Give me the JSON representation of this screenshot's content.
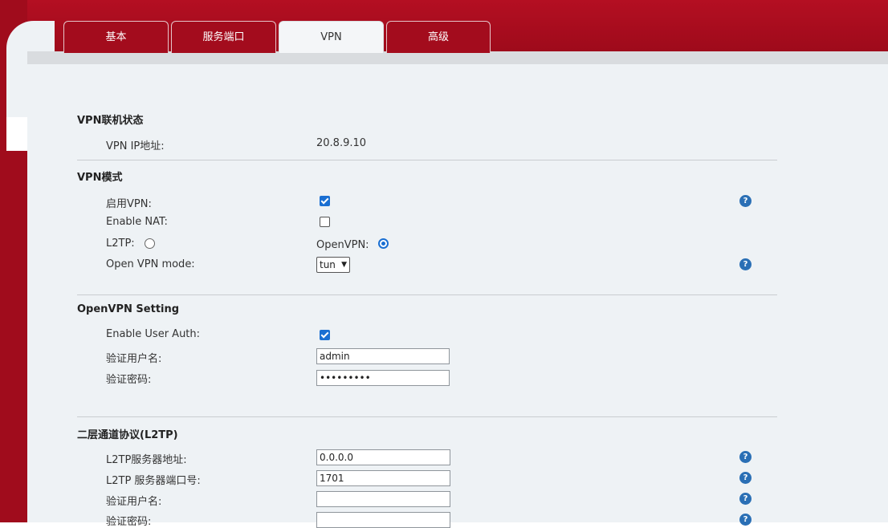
{
  "tabs": [
    {
      "label": "基本",
      "active": false
    },
    {
      "label": "服务端口",
      "active": false
    },
    {
      "label": "VPN",
      "active": true
    },
    {
      "label": "高级",
      "active": false
    }
  ],
  "vpn_status": {
    "title": "VPN联机状态",
    "ip_label": "VPN IP地址:",
    "ip_value": "20.8.9.10"
  },
  "vpn_mode": {
    "title": "VPN模式",
    "enable_vpn_label": "启用VPN:",
    "enable_vpn_checked": true,
    "enable_nat_label": "Enable NAT:",
    "enable_nat_checked": false,
    "l2tp_label": "L2TP:",
    "l2tp_selected": false,
    "openvpn_label": "OpenVPN:",
    "openvpn_selected": true,
    "openvpn_mode_label": "Open VPN mode:",
    "openvpn_mode_value": "tun"
  },
  "openvpn_setting": {
    "title": "OpenVPN Setting",
    "user_auth_label": "Enable User Auth:",
    "user_auth_checked": true,
    "username_label": "验证用户名:",
    "username_value": "admin",
    "password_label": "验证密码:",
    "password_value": "•••••••••"
  },
  "l2tp": {
    "title": "二层通道协议(L2TP)",
    "server_label": "L2TP服务器地址:",
    "server_value": "0.0.0.0",
    "port_label": "L2TP 服务器端口号:",
    "port_value": "1701",
    "username_label": "验证用户名:",
    "username_value": "",
    "password_label": "验证密码:",
    "password_value": ""
  },
  "help_icon": "question-mark-icon",
  "colors": {
    "brand_red": "#a30c1d",
    "checkbox_blue": "#1a6fd2",
    "help_blue": "#2a6fb5",
    "content_bg": "#eef2f5"
  }
}
